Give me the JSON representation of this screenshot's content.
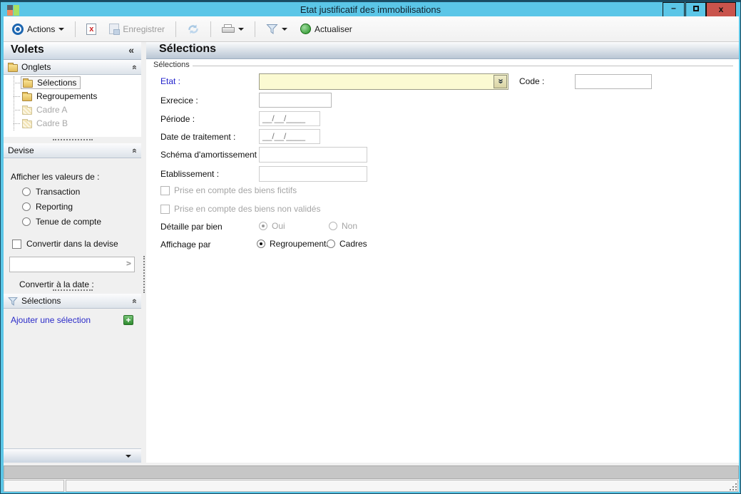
{
  "window": {
    "title": "Etat justificatif des immobilisations",
    "controls": {
      "minimize_glyph": "–",
      "close_glyph": "x"
    }
  },
  "toolbar": {
    "actions_label": "Actions",
    "enregistrer_label": "Enregistrer",
    "actualiser_label": "Actualiser"
  },
  "icons": {
    "collapse_left_glyph": "«",
    "chevron_double_glyph": "«",
    "plus_glyph": "+",
    "docx_glyph": "x"
  },
  "sidebar": {
    "title": "Volets",
    "onglets": {
      "header": "Onglets",
      "items": [
        {
          "label": "Sélections"
        },
        {
          "label": "Regroupements"
        },
        {
          "label": "Cadre A"
        },
        {
          "label": "Cadre B"
        }
      ]
    },
    "devise": {
      "header": "Devise",
      "values_label": "Afficher les valeurs de :",
      "options": [
        {
          "label": "Transaction"
        },
        {
          "label": "Reporting"
        },
        {
          "label": "Tenue de compte"
        }
      ],
      "convert_checkbox_label": "Convertir dans la devise",
      "convert_date_label": "Convertir à la date :"
    },
    "selections": {
      "header": "Sélections",
      "add_link": "Ajouter une sélection"
    }
  },
  "main": {
    "header": "Sélections",
    "group_title": "Sélections",
    "fields": {
      "etat_label": "Etat :",
      "code_label": "Code :",
      "exercice_label": "Exrecice :",
      "periode_label": "Période :",
      "periode_mask": "__/__/____",
      "date_traitement_label": "Date de traitement :",
      "date_traitement_mask": "__/__/____",
      "schema_label": "Schéma d'amortissement :",
      "etablissement_label": "Etablissement :",
      "fictifs_label": "Prise en compte des biens fictifs",
      "non_valides_label": "Prise en compte des biens non validés",
      "detaille_label": "Détaille par bien",
      "detaille_oui": "Oui",
      "detaille_non": "Non",
      "affichage_label": "Affichage par",
      "affichage_regroupements": "Regroupements",
      "affichage_cadres": "Cadres"
    }
  },
  "colors": {
    "titlebar": "#5bc6e7",
    "close_button": "#c9544c",
    "required_field_bg": "#fbfad2",
    "link_blue": "#2a2ac8",
    "label_blue": "#2222cc"
  }
}
